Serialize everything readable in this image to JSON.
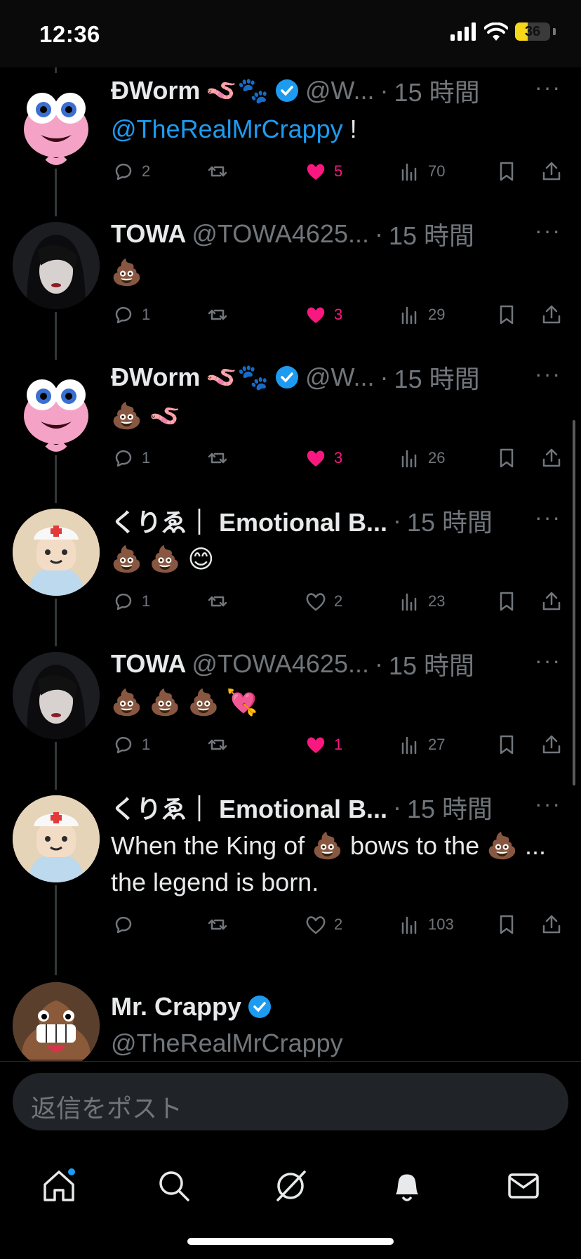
{
  "status_bar": {
    "time": "12:36",
    "battery": "36"
  },
  "tweets": [
    {
      "name": "ÐWorm",
      "name_emoji": "🪱🐾",
      "handle": "@W...",
      "dot": "·",
      "time": "15 時間",
      "text_before": "",
      "mention": "@TheRealMrCrappy",
      "text_after": " !",
      "replies": "2",
      "reposts": "",
      "likes": "5",
      "liked": true,
      "views": "70",
      "avatar": "worm-avatar",
      "verified": true
    },
    {
      "name": "TOWA",
      "name_emoji": "",
      "handle": "@TOWA4625...",
      "dot": "·",
      "time": "15 時間",
      "text_before": "💩",
      "mention": "",
      "text_after": "",
      "replies": "1",
      "reposts": "",
      "likes": "3",
      "liked": true,
      "views": "29",
      "avatar": "dark-avatar",
      "verified": false
    },
    {
      "name": "ÐWorm",
      "name_emoji": "🪱🐾",
      "handle": "@W...",
      "dot": "·",
      "time": "15 時間",
      "text_before": "💩 🪱",
      "mention": "",
      "text_after": "",
      "replies": "1",
      "reposts": "",
      "likes": "3",
      "liked": true,
      "views": "26",
      "avatar": "worm-avatar",
      "verified": true
    },
    {
      "name": "くりゑ｜ Emotional B...",
      "name_emoji": "",
      "handle": "",
      "dot": "·",
      "time": "15 時間",
      "text_before": "💩 💩 😊",
      "mention": "",
      "text_after": "",
      "replies": "1",
      "reposts": "",
      "likes": "2",
      "liked": false,
      "views": "23",
      "avatar": "nurse-avatar",
      "verified": false
    },
    {
      "name": "TOWA",
      "name_emoji": "",
      "handle": "@TOWA4625...",
      "dot": "·",
      "time": "15 時間",
      "text_before": "💩 💩 💩 💘",
      "mention": "",
      "text_after": "",
      "replies": "1",
      "reposts": "",
      "likes": "1",
      "liked": true,
      "views": "27",
      "avatar": "dark-avatar",
      "verified": false
    },
    {
      "name": "くりゑ｜ Emotional B...",
      "name_emoji": "",
      "handle": "",
      "dot": "·",
      "time": "15 時間",
      "text_before": "When the King of 💩 bows to the 💩 ... the legend is born.",
      "mention": "",
      "text_after": "",
      "replies": "",
      "reposts": "",
      "likes": "2",
      "liked": false,
      "views": "103",
      "avatar": "nurse-avatar",
      "verified": false
    }
  ],
  "op": {
    "name": "Mr. Crappy",
    "handle": "@TheRealMrCrappy",
    "verified": true,
    "avatar": "poop-avatar"
  },
  "composer": {
    "placeholder": "返信をポスト"
  },
  "tabs": [
    "home-icon",
    "search-icon",
    "grok-icon",
    "notifications-icon",
    "messages-icon"
  ],
  "colors": {
    "accent": "#1d9bf0",
    "like": "#f91880",
    "muted": "#71767b",
    "battery": "#f7d71a"
  }
}
